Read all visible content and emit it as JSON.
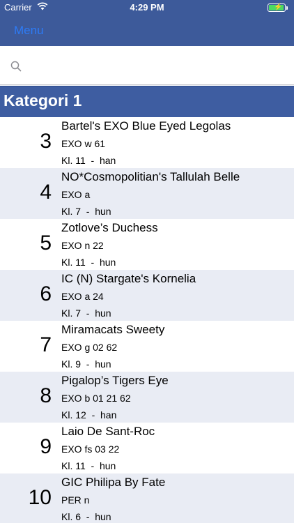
{
  "status_bar": {
    "carrier": "Carrier",
    "time": "4:29 PM"
  },
  "nav": {
    "menu_label": "Menu"
  },
  "search": {
    "placeholder": ""
  },
  "section": {
    "title": "Kategori 1"
  },
  "rows": [
    {
      "number": "3",
      "name": "Bartel's EXO Blue Eyed Legolas",
      "breed": "EXO w 61",
      "class_info": "Kl. 11  -  han"
    },
    {
      "number": "4",
      "name": "NO*Cosmopolitian's Tallulah Belle",
      "breed": "EXO a",
      "class_info": "Kl. 7  -  hun"
    },
    {
      "number": "5",
      "name": "Zotlove’s Duchess",
      "breed": "EXO n 22",
      "class_info": "Kl. 11  -  hun"
    },
    {
      "number": "6",
      "name": "IC (N) Stargate's Kornelia",
      "breed": "EXO a 24",
      "class_info": "Kl. 7  -  hun"
    },
    {
      "number": "7",
      "name": "Miramacats Sweety",
      "breed": "EXO g 02 62",
      "class_info": "Kl. 9  -  hun"
    },
    {
      "number": "8",
      "name": "Pigalop’s Tigers Eye",
      "breed": "EXO b 01 21 62",
      "class_info": "Kl. 12  -  han"
    },
    {
      "number": "9",
      "name": "Laio De Sant-Roc",
      "breed": "EXO fs 03 22",
      "class_info": "Kl. 11  -  hun"
    },
    {
      "number": "10",
      "name": "GIC Philipa By Fate",
      "breed": "PER n",
      "class_info": "Kl. 6  -  hun"
    }
  ],
  "colors": {
    "navbar": "#3d5a9a",
    "section_header": "#3e5da1",
    "row_alt": "#e9ecf4",
    "menu_link": "#2d7bf6",
    "battery": "#4cd964"
  },
  "icons": {
    "wifi": "wifi-icon",
    "battery": "battery-icon",
    "search": "search-icon"
  }
}
